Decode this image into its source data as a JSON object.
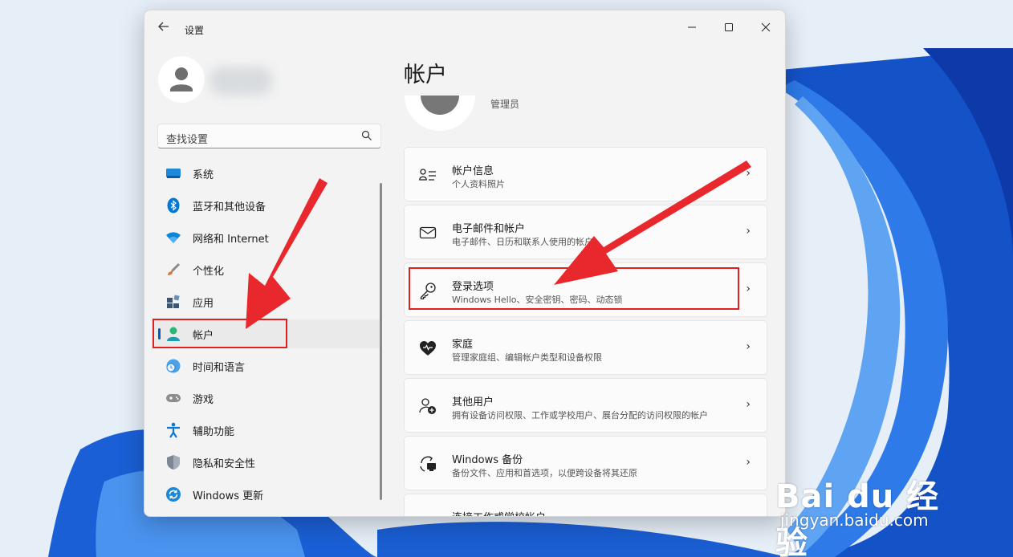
{
  "window": {
    "title": "设置",
    "back_icon": "back-arrow-icon",
    "controls": [
      "minimize",
      "maximize",
      "close"
    ]
  },
  "sidebar": {
    "search_placeholder": "查找设置",
    "items": [
      {
        "label": "系统",
        "icon": "monitor-icon",
        "color": "#0078d4"
      },
      {
        "label": "蓝牙和其他设备",
        "icon": "bluetooth-icon",
        "color": "#0078d4"
      },
      {
        "label": "网络和 Internet",
        "icon": "wifi-icon",
        "color": "#0a84d6"
      },
      {
        "label": "个性化",
        "icon": "paintbrush-icon",
        "color": "#c0713a"
      },
      {
        "label": "应用",
        "icon": "apps-icon",
        "color": "#4a5f72"
      },
      {
        "label": "帐户",
        "icon": "person-icon",
        "color": "#2bb673",
        "active": true
      },
      {
        "label": "时间和语言",
        "icon": "globe-clock-icon",
        "color": "#2b86d6"
      },
      {
        "label": "游戏",
        "icon": "gamepad-icon",
        "color": "#7a7a7a"
      },
      {
        "label": "辅助功能",
        "icon": "accessibility-icon",
        "color": "#0a78d6"
      },
      {
        "label": "隐私和安全性",
        "icon": "shield-icon",
        "color": "#6b7785"
      },
      {
        "label": "Windows 更新",
        "icon": "sync-icon",
        "color": "#0a78d6"
      }
    ]
  },
  "main": {
    "title": "帐户",
    "role": "管理员",
    "cards": [
      {
        "title": "帐户信息",
        "subtitle": "个人资料照片",
        "icon": "person-list-icon"
      },
      {
        "title": "电子邮件和帐户",
        "subtitle": "电子邮件、日历和联系人使用的帐户",
        "icon": "mail-icon"
      },
      {
        "title": "登录选项",
        "subtitle": "Windows Hello、安全密钥、密码、动态锁",
        "icon": "key-icon",
        "highlighted": true
      },
      {
        "title": "家庭",
        "subtitle": "管理家庭组、编辑帐户类型和设备权限",
        "icon": "heart-icon"
      },
      {
        "title": "其他用户",
        "subtitle": "拥有设备访问权限、工作或学校用户、展台分配的访问权限的帐户",
        "icon": "person-add-icon"
      },
      {
        "title": "Windows 备份",
        "subtitle": "备份文件、应用和首选项，以便跨设备将其还原",
        "icon": "backup-icon"
      },
      {
        "title": "连接工作或学校帐户",
        "subtitle": "",
        "icon": "briefcase-icon"
      }
    ]
  },
  "watermark": {
    "brand": "Bai du 经验",
    "url": "jingyan.baidu.com"
  },
  "annotation_color": "#e02020"
}
